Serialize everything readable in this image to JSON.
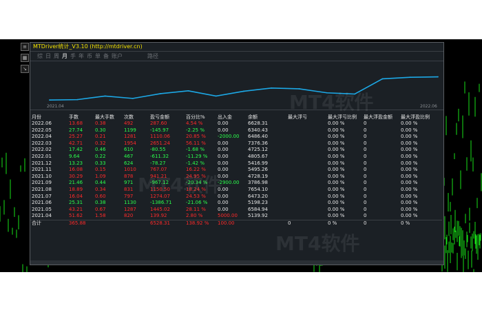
{
  "window": {
    "title": "MTDriver统计_V3.10 (http://mtdriver.cn)",
    "tabs": [
      "综",
      "日",
      "周",
      "月",
      "手",
      "年",
      "币",
      "单",
      "备",
      "账户",
      "路径"
    ],
    "active_tab": "月"
  },
  "graph": {
    "start_label": "2021.04",
    "end_label": "2022.06",
    "points": [
      0.1,
      0.11,
      0.2,
      0.14,
      0.26,
      0.33,
      0.2,
      0.32,
      0.4,
      0.38,
      0.28,
      0.25,
      0.63,
      0.67,
      0.68
    ]
  },
  "table": {
    "headers": [
      "月份",
      "手数",
      "最大手数",
      "次数",
      "盈亏金额",
      "百分比%",
      "出入金",
      "余额",
      "最大浮亏",
      "最大浮亏比例",
      "最大浮盈金额",
      "最大浮盈比例"
    ],
    "rows": [
      {
        "c": [
          "2022.06",
          "13.68",
          "0.38",
          "492",
          "287.60",
          "4.54 %",
          "0.00",
          "6628.31",
          "",
          "0.00 %",
          "0",
          "0.00 %"
        ],
        "sign": "neg"
      },
      {
        "c": [
          "2022.05",
          "27.74",
          "0.30",
          "1199",
          "-145.97",
          "-2.25 %",
          "0.00",
          "6340.43",
          "",
          "0.00 %",
          "0",
          "0.00 %"
        ],
        "sign": "pos"
      },
      {
        "c": [
          "2022.04",
          "25.27",
          "0.21",
          "1281",
          "1110.06",
          "20.85 %",
          "-2000.00",
          "6486.40",
          "",
          "0.00 %",
          "0",
          "0.00 %"
        ],
        "sign": "neg"
      },
      {
        "c": [
          "2022.03",
          "42.71",
          "0.32",
          "1954",
          "2651.24",
          "56.11 %",
          "0.00",
          "7376.36",
          "",
          "0.00 %",
          "0",
          "0.00 %"
        ],
        "sign": "neg"
      },
      {
        "c": [
          "2022.02",
          "17.42",
          "0.46",
          "610",
          "-80.55",
          "-1.68 %",
          "0.00",
          "4725.12",
          "",
          "0.00 %",
          "0",
          "0.00 %"
        ],
        "sign": "pos"
      },
      {
        "c": [
          "2022.01",
          "9.64",
          "0.22",
          "467",
          "-611.32",
          "-11.29 %",
          "0.00",
          "4805.67",
          "",
          "0.00 %",
          "0",
          "0.00 %"
        ],
        "sign": "pos"
      },
      {
        "c": [
          "2021.12",
          "13.23",
          "0.33",
          "624",
          "-78.27",
          "-1.42 %",
          "0.00",
          "5416.99",
          "",
          "0.00 %",
          "0",
          "0.00 %"
        ],
        "sign": "pos"
      },
      {
        "c": [
          "2021.11",
          "16.08",
          "0.15",
          "1010",
          "767.07",
          "16.22 %",
          "0.00",
          "5495.26",
          "",
          "0.00 %",
          "0",
          "0.00 %"
        ],
        "sign": "neg"
      },
      {
        "c": [
          "2021.10",
          "30.29",
          "1.09",
          "878",
          "941.21",
          "24.95 %",
          "0.00",
          "4728.19",
          "",
          "0.00 %",
          "0",
          "0.00 %"
        ],
        "sign": "neg"
      },
      {
        "c": [
          "2021.09",
          "21.46",
          "0.44",
          "971",
          "-967.12",
          "-20.34 %",
          "-2900.00",
          "3786.98",
          "",
          "0.00 %",
          "0",
          "0.00 %"
        ],
        "sign": "pos"
      },
      {
        "c": [
          "2021.08",
          "18.89",
          "0.34",
          "831",
          "1150.50",
          "18.24 %",
          "0.00",
          "7654.10",
          "",
          "0.00 %",
          "0",
          "0.00 %"
        ],
        "sign": "neg"
      },
      {
        "c": [
          "2021.07",
          "16.04",
          "0.60",
          "797",
          "1274.07",
          "24.53 %",
          "0.00",
          "6473.20",
          "",
          "0.00 %",
          "0",
          "0.00 %"
        ],
        "sign": "neg"
      },
      {
        "c": [
          "2021.06",
          "25.31",
          "0.38",
          "1130",
          "-1386.71",
          "-21.06 %",
          "0.00",
          "5198.23",
          "",
          "0.00 %",
          "0",
          "0.00 %"
        ],
        "sign": "pos"
      },
      {
        "c": [
          "2021.05",
          "43.21",
          "0.67",
          "1287",
          "1445.02",
          "28.11 %",
          "0.00",
          "6584.94",
          "",
          "0.00 %",
          "0",
          "0.00 %"
        ],
        "sign": "neg"
      },
      {
        "c": [
          "2021.04",
          "51.62",
          "1.58",
          "820",
          "139.92",
          "2.80 %",
          "5000.00",
          "5139.92",
          "",
          "0.00 %",
          "0",
          "0.00 %"
        ],
        "sign": "neg"
      }
    ],
    "total": [
      "合计",
      "365.88",
      "",
      "",
      "6528.31",
      "138.92 %",
      "100.00",
      "",
      "0",
      "0 %",
      "0",
      "0 %"
    ]
  },
  "watermark": "MT4软件"
}
